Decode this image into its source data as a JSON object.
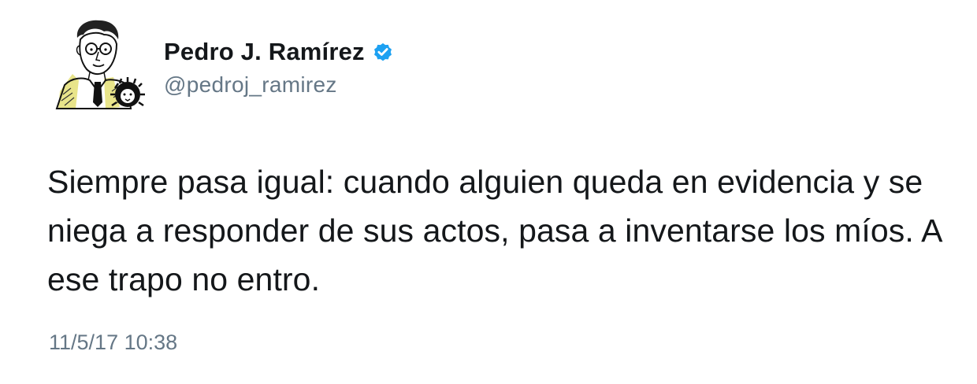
{
  "author": {
    "display_name": "Pedro J. Ramírez",
    "handle": "@pedroj_ramirez",
    "verified": true,
    "avatar_icon": "caricature-portrait-with-lion-avatar",
    "verified_icon": "verified-badge-icon",
    "verified_color": "#1da1f2"
  },
  "tweet": {
    "text": "Siempre pasa igual: cuando alguien queda en evidencia y se niega a responder de sus actos, pasa a inventarse los míos. A ese trapo no entro.",
    "timestamp": "11/5/17 10:38"
  },
  "colors": {
    "text": "#14171a",
    "secondary": "#657786",
    "avatar_accent": "#e8e48a"
  }
}
